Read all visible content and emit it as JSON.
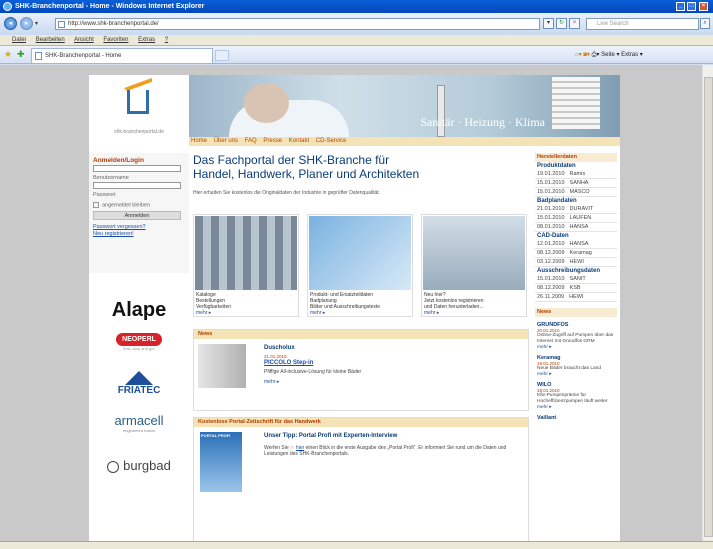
{
  "browser": {
    "window_title": "SHK-Branchenportal - Home - Windows Internet Explorer",
    "url": "http://www.shk-branchenportal.de/",
    "search_placeholder": "Live Search",
    "menu": [
      "Datei",
      "Bearbeiten",
      "Ansicht",
      "Favoriten",
      "Extras",
      "?"
    ],
    "tab_title": "SHK-Branchenportal - Home",
    "command_bar": "Seite ▾   Extras ▾"
  },
  "site": {
    "logo_text": "shk-branchenportal.de",
    "hero_text": "Sanitär · Heizung · Klima",
    "nav": [
      "Home",
      "Über uns",
      "FAQ",
      "Presse",
      "Kontakt",
      "CD-Service"
    ]
  },
  "login": {
    "title": "Anmelden/Login",
    "username_label": "Benutzername",
    "password_label": "Passwort",
    "remember_label": "angemeldet bleiben",
    "submit": "Anmelden",
    "forgot": "Passwort vergessen?",
    "register": "Neu registrieren!"
  },
  "partners": {
    "alape": "Alape",
    "neoperl": "NEOPERL",
    "neoperl_tag": "flow, stop and go!",
    "friatec": "FRIATEC",
    "armacell": "armacell",
    "armacell_tag": "engineered foams",
    "burgbad": "burgbad"
  },
  "main": {
    "heading_line1": "Das Fachportal der SHK-Branche für",
    "heading_line2": "Handel, Handwerk, Planer und Architekten",
    "intro": "Hier erhalten Sie kostenlos die Originaldaten der Industrie in geprüfter Datenqualität.",
    "tiles": [
      {
        "text": "Kataloge\nBestellungen\nVerfügbarkeiten",
        "more": "mehr ▸"
      },
      {
        "text": "Produkt- und Ersatzteildaten\nBadplanung\nBilder und Ausschreibungstexte",
        "more": "mehr ▸"
      },
      {
        "text": "Neu hier?\nJetzt kostenlos registrieren\nund Daten herunterladen...",
        "more": "mehr ▸"
      }
    ],
    "news": {
      "title": "News",
      "company": "Duscholux",
      "date": "21.01.2010",
      "headline": "PICCOLO Step-in",
      "text": "Pfiffige All-inclusive-Lösung für kleine Bäder",
      "more": "mehr ▸"
    },
    "magazine": {
      "title": "Kostenlose Portal-Zeitschrift für das Handwerk",
      "cover_label": "PORTAL PROFI",
      "headline": "Unser Tipp: Portal Profi mit Experten-Interview",
      "text_pre": "Werfen Sie",
      "text_link": "hier",
      "text_post": "einen Blick in die erste Ausgabe des „Portal Profi“. Er informiert Sie rund um die Daten und Leistungen des SHK-Branchenportals."
    }
  },
  "right": {
    "title": "Herstellerdaten",
    "groups": [
      {
        "name": "Produktdaten",
        "rows": [
          [
            "19.01.2010",
            "Ramis"
          ],
          [
            "15.01.2010",
            "SANHA"
          ],
          [
            "15.01.2010",
            "MASCO"
          ]
        ]
      },
      {
        "name": "Badplandaten",
        "rows": [
          [
            "21.01.2010",
            "DURAVIT"
          ],
          [
            "15.01.2010",
            "LAUFEN"
          ],
          [
            "08.01.2010",
            "HANSA"
          ]
        ]
      },
      {
        "name": "CAD-Daten",
        "rows": [
          [
            "12.01.2010",
            "HANSA"
          ],
          [
            "08.12.2009",
            "Keramag"
          ],
          [
            "03.12.2009",
            "HEWI"
          ]
        ]
      },
      {
        "name": "Ausschreibungsdaten",
        "rows": [
          [
            "15.01.2010",
            "SANIT"
          ],
          [
            "08.12.2009",
            "KSB"
          ],
          [
            "26.11.2009",
            "HEWI"
          ]
        ]
      }
    ],
    "news_title": "News",
    "news": [
      {
        "name": "GRUNDFOS",
        "date": "20.01.2010",
        "text": "Online-Zugriff auf Pumpen über das Internet mit Grundfos GRM",
        "more": "mehr ▸"
      },
      {
        "name": "Keramag",
        "date": "19.01.2010",
        "text": "Neue Bäder braucht das Land",
        "more": "mehr ▸"
      },
      {
        "name": "WILO",
        "date": "18.01.2010",
        "text": "Kfw-Pumpenprämie für Hocheffizienzpumpen läuft weiter",
        "more": "mehr ▸"
      },
      {
        "name": "Vaillant",
        "date": "",
        "text": "",
        "more": ""
      }
    ]
  }
}
